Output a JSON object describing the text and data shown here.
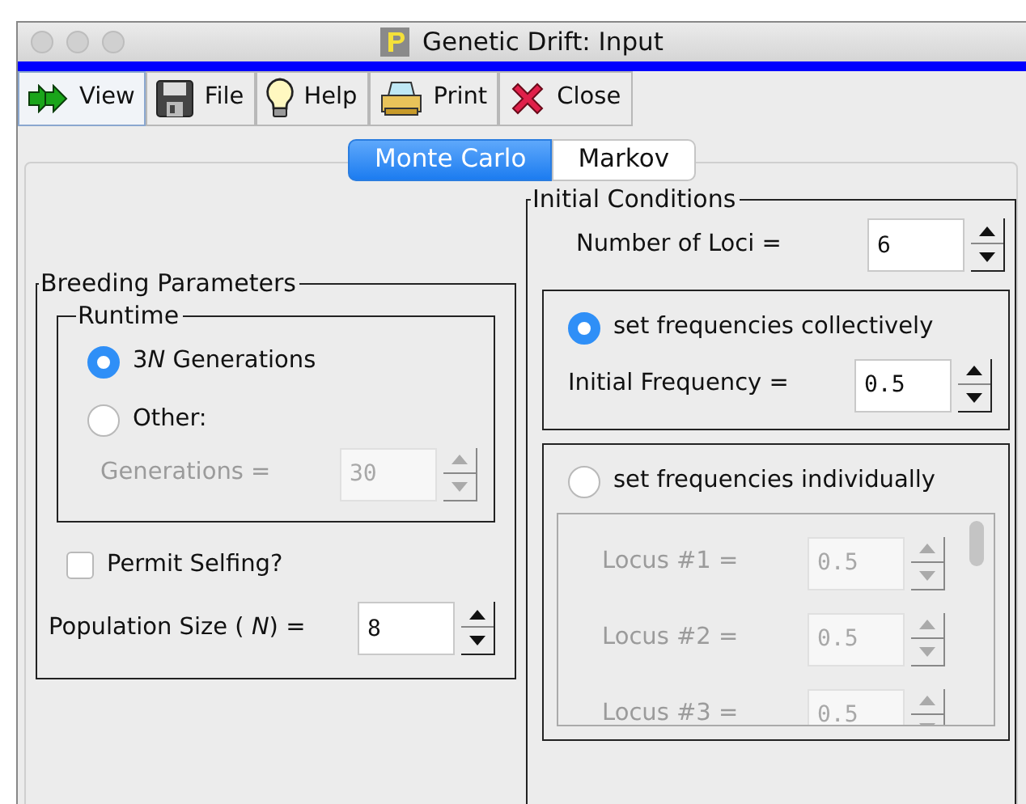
{
  "window": {
    "title": "Genetic Drift: Input"
  },
  "toolbar": [
    {
      "kind": "arrows",
      "label": "View",
      "selected": true
    },
    {
      "kind": "disk",
      "label": "File",
      "selected": false
    },
    {
      "kind": "bulb",
      "label": "Help",
      "selected": false
    },
    {
      "kind": "printer",
      "label": "Print",
      "selected": false
    },
    {
      "kind": "cross",
      "label": "Close",
      "selected": false
    }
  ],
  "tabs": [
    {
      "label": "Monte Carlo",
      "selected": true
    },
    {
      "label": "Markov",
      "selected": false
    }
  ],
  "breeding_parameters": {
    "title": "Breeding Parameters",
    "runtime": {
      "title": "Runtime",
      "options": [
        {
          "label": [
            "3",
            "*N*",
            " Generations"
          ],
          "selected": true
        },
        {
          "label": "Other:",
          "selected": false
        }
      ],
      "generations": {
        "label": "Generations =",
        "value": "30"
      }
    },
    "permit_selfing": {
      "label": "Permit Selfing?",
      "checked": false
    },
    "population_size": {
      "label": "Population Size ( *N*) =",
      "value": "8"
    }
  },
  "initial_conditions": {
    "title": "Initial Conditions",
    "number_of_loci": {
      "label": "Number of Loci =",
      "value": "6"
    },
    "collective": {
      "label": "set frequencies collectively",
      "selected": true,
      "initial_frequency": {
        "label": "Initial Frequency =",
        "value": "0.5"
      }
    },
    "individual": {
      "label": "set frequencies individually",
      "selected": false,
      "loci": [
        {
          "label": "Locus #1 =",
          "value": "0.5"
        },
        {
          "label": "Locus #2 =",
          "value": "0.5"
        },
        {
          "label": "Locus #3 =",
          "value": "0.5"
        }
      ]
    }
  }
}
